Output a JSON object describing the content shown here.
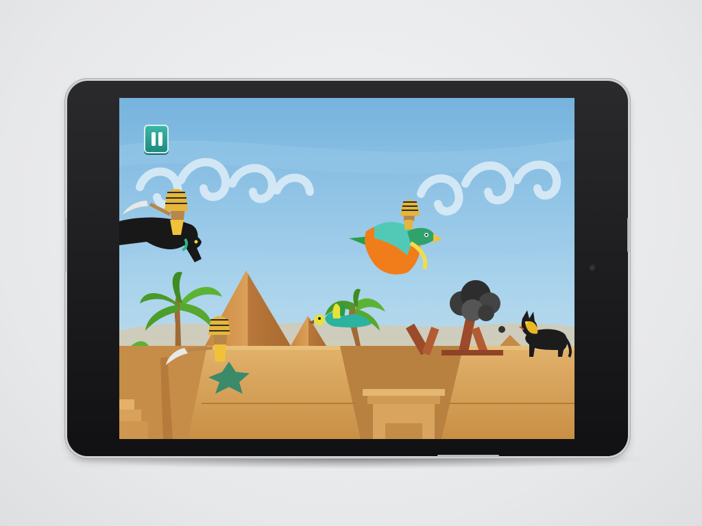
{
  "device": {
    "type": "tablet",
    "orientation": "landscape",
    "bezel_color": "#141416",
    "frame_color": "#c8cacd"
  },
  "game": {
    "theme": "egyptian-desert-runner",
    "controls": {
      "pause": {
        "icon": "pause-icon",
        "color": "#2aa094"
      }
    },
    "scene": {
      "sky_color": "#7fb9e1",
      "sand_color": "#d9a35a",
      "characters": [
        {
          "id": "pharaoh-on-black-panther",
          "icon": "pharaoh-rider-icon"
        },
        {
          "id": "pharaoh-on-horus-falcon",
          "icon": "falcon-rider-icon"
        },
        {
          "id": "pharaoh-on-star",
          "icon": "star-rider-icon"
        },
        {
          "id": "green-falcon-enemy",
          "icon": "falcon-icon"
        },
        {
          "id": "black-jackal-enemy",
          "icon": "jackal-icon"
        }
      ],
      "obstacles": [
        {
          "id": "broken-wooden-barricade",
          "icon": "barricade-icon"
        },
        {
          "id": "smoke-cloud",
          "icon": "smoke-icon"
        }
      ],
      "scenery": [
        "pyramid",
        "palm-tree",
        "temple-platform",
        "clouds"
      ]
    }
  }
}
